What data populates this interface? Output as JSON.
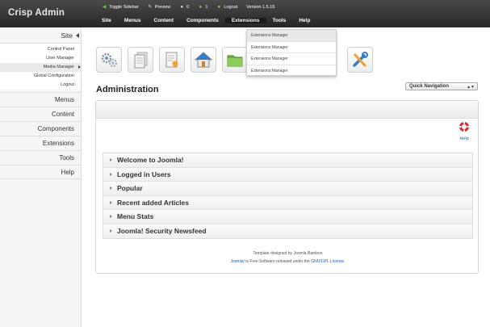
{
  "app": {
    "brand": "Crisp Admin"
  },
  "utilities": [
    {
      "icon": "toggle-sidebar-icon",
      "label": "Toggle Sidebar"
    },
    {
      "icon": "preview-icon",
      "label": "Preview"
    },
    {
      "icon": "messages-icon",
      "label": "0"
    },
    {
      "icon": "users-online-icon",
      "label": "1"
    },
    {
      "icon": "logout-icon",
      "label": "Logout"
    },
    {
      "icon": "",
      "label": "Version 1.5.15"
    }
  ],
  "main_nav": [
    "Site",
    "Menus",
    "Content",
    "Components",
    "Extensions",
    "Tools",
    "Help"
  ],
  "extensions_dropdown": [
    "Extensions Manager",
    "Extensions Manager",
    "Extensions Manager",
    "Extensions Manager"
  ],
  "sidebar": {
    "heading": "Site",
    "subitems": [
      "Control Panel",
      "User Manager",
      "Media Manager",
      "Global Configuration",
      "Logout"
    ],
    "links": [
      "Menus",
      "Content",
      "Components",
      "Extensions",
      "Tools",
      "Help"
    ]
  },
  "quick_icons": [
    "gears-icon",
    "articles-icon",
    "document-edit-icon",
    "home-icon",
    "folder-icon",
    "tools-icon"
  ],
  "page": {
    "title": "Administration",
    "quick_nav": "Quick Navigation",
    "help_label": "Help"
  },
  "modules": [
    "Welcome to Joomla!",
    "Logged in Users",
    "Popular",
    "Recent added Articles",
    "Menu Stats",
    "Joomla! Security Newsfeed"
  ],
  "footer": {
    "line1": "Template designed by Joomla Bamboo",
    "joomla_link": "Joomla!",
    "middle": " is Free Software released under the ",
    "license_link": "GNU/GPL License",
    "end": "."
  },
  "colors": {
    "topbar": "#333333",
    "link": "#2262a8"
  }
}
